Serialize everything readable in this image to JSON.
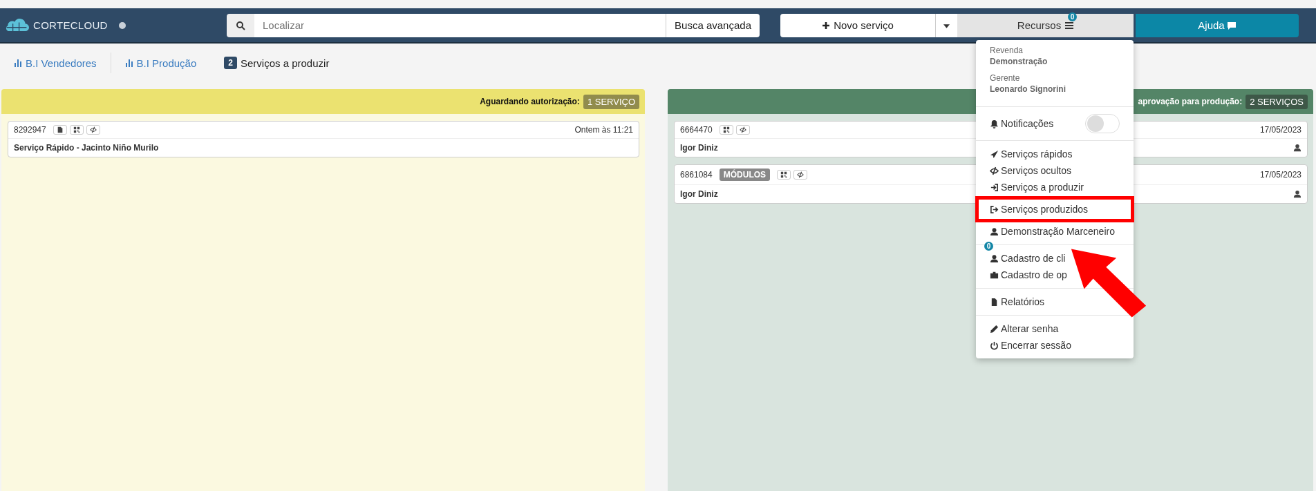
{
  "brand": {
    "name": "CORTECLOUD"
  },
  "search": {
    "placeholder": "Localizar",
    "advanced": "Busca avançada"
  },
  "new_button": "Novo serviço",
  "resources": {
    "label": "Recursos",
    "badge": "0",
    "expanded": true
  },
  "help": "Ajuda",
  "tabs": [
    {
      "kind": "chart",
      "label": "B.I Vendedores"
    },
    {
      "kind": "chart",
      "label": "B.I Produção"
    },
    {
      "kind": "count",
      "count": "2",
      "label": "Serviços a produzir"
    }
  ],
  "columns": [
    {
      "title": "Aguardando autorização:",
      "count": "1 SERVIÇO",
      "color": "#ebe270",
      "cards": [
        {
          "id": "8292947",
          "document": true,
          "date": "Ontem às 11:21",
          "title": "Serviço Rápido - Jacinto Niño Murilo",
          "person": false
        }
      ]
    },
    {
      "title": "aprovação para produção:",
      "count": "2 SERVIÇOS",
      "color": "#548567",
      "cards": [
        {
          "id": "6664470",
          "document": false,
          "date": "17/05/2023",
          "title": "Igor Diniz",
          "person": true
        },
        {
          "id": "6861084",
          "tag": "MÓDULOS",
          "document": false,
          "date": "17/05/2023",
          "title": "Igor Diniz",
          "person": true
        }
      ]
    }
  ],
  "menu": {
    "info": [
      {
        "label": "Revenda",
        "value": "Demonstração"
      },
      {
        "label": "Gerente",
        "value": "Leonardo Signorini"
      }
    ],
    "toggle": {
      "label": "Notificações",
      "on": false
    },
    "groups": [
      [
        {
          "label": "Serviços rápidos",
          "highlighted": false
        },
        {
          "label": "Serviços ocultos",
          "highlighted": false
        },
        {
          "label": "Serviços a produzir",
          "highlighted": false
        },
        {
          "label": "Serviços produzidos",
          "highlighted": true
        },
        {
          "label": "Demonstração Marceneiro",
          "highlighted": false
        }
      ],
      [
        {
          "label": "Cadastro de cli",
          "badge": "0",
          "highlighted": false
        },
        {
          "label": "Cadastro de op",
          "highlighted": false
        }
      ],
      [
        {
          "label": "Relatórios",
          "highlighted": false
        }
      ],
      [
        {
          "label": "Alterar senha",
          "highlighted": false
        },
        {
          "label": "Encerrar sessão",
          "highlighted": false
        }
      ]
    ]
  }
}
